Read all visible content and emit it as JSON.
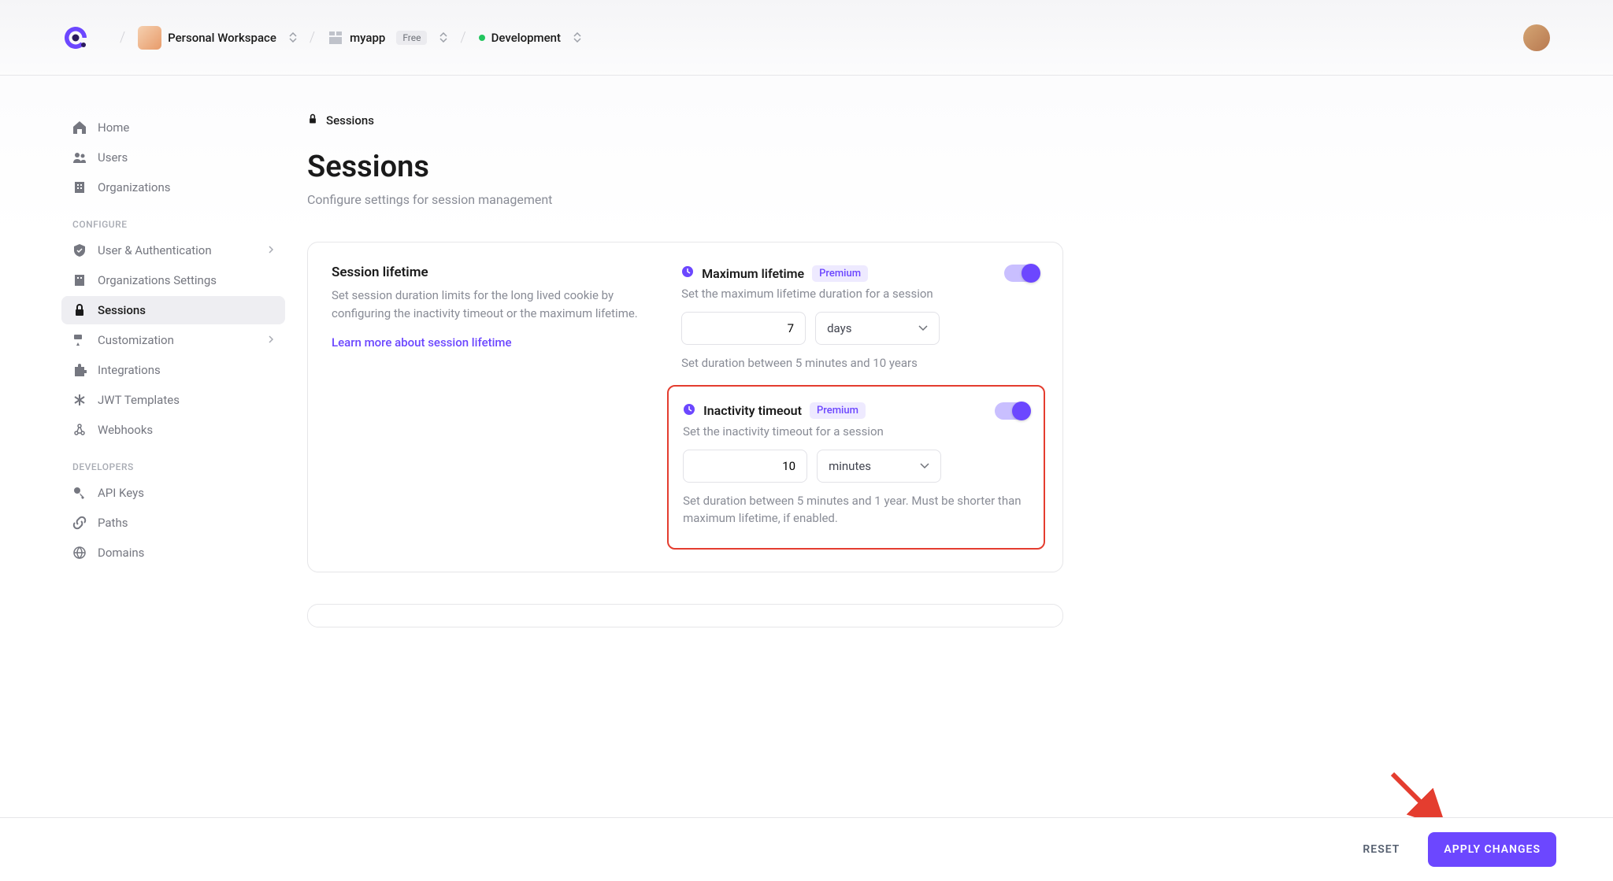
{
  "topbar": {
    "workspace": "Personal Workspace",
    "app": "myapp",
    "app_badge": "Free",
    "env": "Development"
  },
  "sidebar": {
    "items": [
      {
        "label": "Home"
      },
      {
        "label": "Users"
      },
      {
        "label": "Organizations"
      }
    ],
    "section_configure": "CONFIGURE",
    "configure": [
      {
        "label": "User & Authentication"
      },
      {
        "label": "Organizations Settings"
      },
      {
        "label": "Sessions"
      },
      {
        "label": "Customization"
      },
      {
        "label": "Integrations"
      },
      {
        "label": "JWT Templates"
      },
      {
        "label": "Webhooks"
      }
    ],
    "section_developers": "DEVELOPERS",
    "developers": [
      {
        "label": "API Keys"
      },
      {
        "label": "Paths"
      },
      {
        "label": "Domains"
      }
    ]
  },
  "page": {
    "crumb": "Sessions",
    "title": "Sessions",
    "subtitle": "Configure settings for session management"
  },
  "card": {
    "title": "Session lifetime",
    "desc": "Set session duration limits for the long lived cookie by configuring the inactivity timeout or the maximum lifetime.",
    "learn": "Learn more about session lifetime"
  },
  "max": {
    "title": "Maximum lifetime",
    "badge": "Premium",
    "desc": "Set the maximum lifetime duration for a session",
    "value": "7",
    "unit": "days",
    "hint": "Set duration between 5 minutes and 10 years"
  },
  "inact": {
    "title": "Inactivity timeout",
    "badge": "Premium",
    "desc": "Set the inactivity timeout for a session",
    "value": "10",
    "unit": "minutes",
    "hint": "Set duration between 5 minutes and 1 year. Must be shorter than maximum lifetime, if enabled."
  },
  "footer": {
    "reset": "RESET",
    "apply": "APPLY CHANGES"
  }
}
